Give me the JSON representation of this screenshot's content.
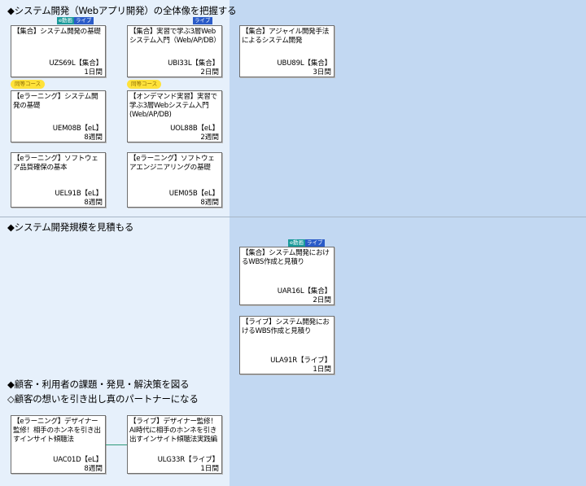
{
  "sections": [
    {
      "title": "◆システム開発（Webアプリ開発）の全体像を把握する"
    },
    {
      "title": "◆システム開発規模を見積もる"
    },
    {
      "title": "◆顧客・利用者の課題・発見・解決策を図る"
    },
    {
      "title": "◇顧客の想いを引き出し真のパートナーになる"
    }
  ],
  "badges": {
    "edo": "e動画",
    "live": "ライブ",
    "doto": "同等コース"
  },
  "courses": [
    {
      "title": "【集合】システム開発の基礎",
      "code": "UZS69L【集合】",
      "duration": "1日間"
    },
    {
      "title": "【集合】実習で学ぶ3層Webシステム入門（Web/AP/DB）",
      "code": "UBI33L【集合】",
      "duration": "2日間"
    },
    {
      "title": "【集合】アジャイル開発手法によるシステム開発",
      "code": "UBU89L【集合】",
      "duration": "3日間"
    },
    {
      "title": "【eラーニング】システム開発の基礎",
      "code": "UEM08B【eL】",
      "duration": "8週間"
    },
    {
      "title": "【オンデマンド実習】実習で学ぶ3層Webシステム入門(Web/AP/DB)",
      "code": "UOL88B【eL】",
      "duration": "2週間"
    },
    {
      "title": "【eラーニング】ソフトウェア品質確保の基本",
      "code": "UEL91B【eL】",
      "duration": "8週間"
    },
    {
      "title": "【eラーニング】ソフトウェアエンジニアリングの基礎",
      "code": "UEM05B【eL】",
      "duration": "8週間"
    },
    {
      "title": "【集合】システム開発におけるWBS作成と見積り",
      "code": "UAR16L【集合】",
      "duration": "2日間"
    },
    {
      "title": "【ライブ】システム開発におけるWBS作成と見積り",
      "code": "ULA91R【ライブ】",
      "duration": "1日間"
    },
    {
      "title": "【eラーニング】デザイナー監修！相手のホンネを引き出すインサイト傾聴法",
      "code": "UAC01D【eL】",
      "duration": "8週間"
    },
    {
      "title": "【ライブ】デザイナー監修！AI時代に相手のホンネを引き出すインサイト傾聴法実践編",
      "code": "ULG33R【ライブ】",
      "duration": "1日間"
    }
  ]
}
